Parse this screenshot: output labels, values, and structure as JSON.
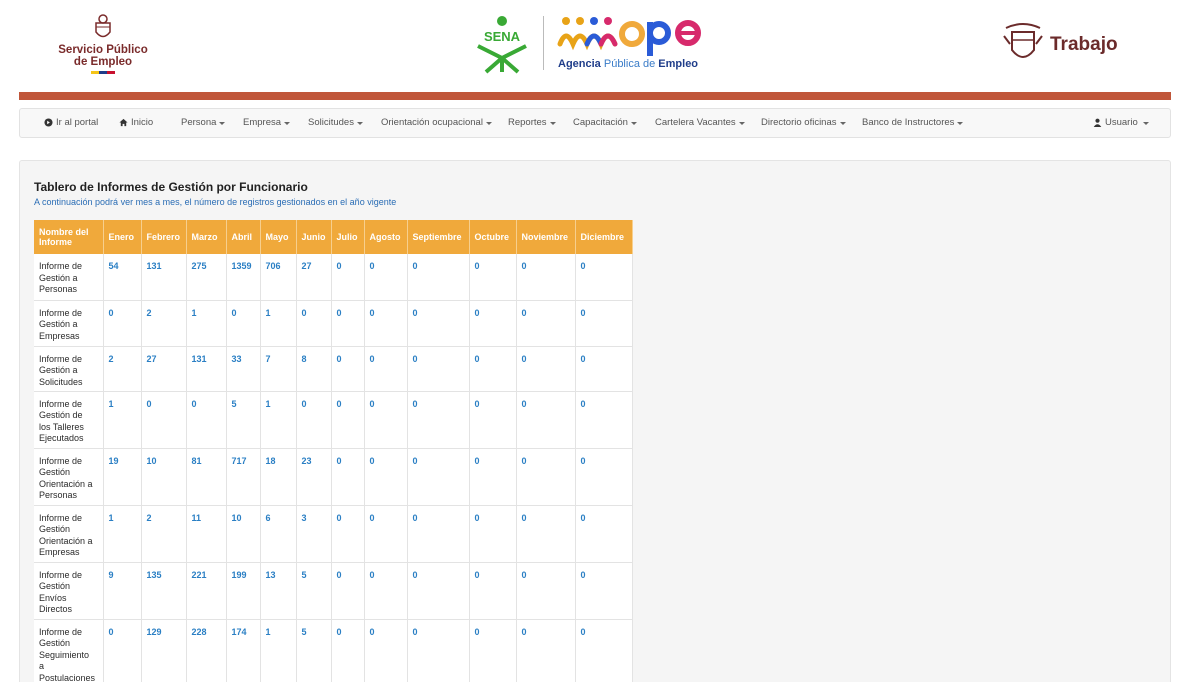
{
  "header": {
    "spe_logo_line1": "Servicio Público",
    "spe_logo_line2": "de Empleo",
    "sena_text": "SENA",
    "ape_sub_bold1": "Agencia",
    "ape_sub_light": "Pública de",
    "ape_sub_bold2": "Empleo",
    "trabajo_text": "Trabajo"
  },
  "navbar": {
    "items": [
      {
        "label": "Ir al portal"
      },
      {
        "label": "Inicio"
      },
      {
        "label": "Persona"
      },
      {
        "label": "Empresa"
      },
      {
        "label": "Solicitudes"
      },
      {
        "label": "Orientación ocupacional"
      },
      {
        "label": "Reportes"
      },
      {
        "label": "Capacitación"
      },
      {
        "label": "Cartelera Vacantes"
      },
      {
        "label": "Directorio oficinas"
      },
      {
        "label": "Banco de Instructores"
      }
    ],
    "user_label": "Usuario"
  },
  "panel": {
    "title": "Tablero de Informes de Gestión por Funcionario",
    "subtitle": "A continuación podrá ver mes a mes, el número de registros gestionados en el año vigente"
  },
  "table": {
    "headers": [
      "Nombre del Informe",
      "Enero",
      "Febrero",
      "Marzo",
      "Abril",
      "Mayo",
      "Junio",
      "Julio",
      "Agosto",
      "Septiembre",
      "Octubre",
      "Noviembre",
      "Diciembre"
    ],
    "rows": [
      {
        "name_lines": [
          "Informe de",
          "Gestión a",
          "Personas"
        ],
        "values": [
          "54",
          "131",
          "275",
          "1359",
          "706",
          "27",
          "0",
          "0",
          "0",
          "0",
          "0",
          "0"
        ]
      },
      {
        "name_lines": [
          "Informe de",
          "Gestión a",
          "Empresas"
        ],
        "values": [
          "0",
          "2",
          "1",
          "0",
          "1",
          "0",
          "0",
          "0",
          "0",
          "0",
          "0",
          "0"
        ]
      },
      {
        "name_lines": [
          "Informe de",
          "Gestión a",
          "Solicitudes"
        ],
        "values": [
          "2",
          "27",
          "131",
          "33",
          "7",
          "8",
          "0",
          "0",
          "0",
          "0",
          "0",
          "0"
        ]
      },
      {
        "name_lines": [
          "Informe de",
          "Gestión de",
          "los Talleres",
          "Ejecutados"
        ],
        "values": [
          "1",
          "0",
          "0",
          "5",
          "1",
          "0",
          "0",
          "0",
          "0",
          "0",
          "0",
          "0"
        ]
      },
      {
        "name_lines": [
          "Informe de",
          "Gestión",
          "Orientación a",
          "Personas"
        ],
        "values": [
          "19",
          "10",
          "81",
          "717",
          "18",
          "23",
          "0",
          "0",
          "0",
          "0",
          "0",
          "0"
        ]
      },
      {
        "name_lines": [
          "Informe de",
          "Gestión",
          "Orientación a",
          "Empresas"
        ],
        "values": [
          "1",
          "2",
          "11",
          "10",
          "6",
          "3",
          "0",
          "0",
          "0",
          "0",
          "0",
          "0"
        ]
      },
      {
        "name_lines": [
          "Informe de",
          "Gestión",
          "Envíos",
          "Directos"
        ],
        "values": [
          "9",
          "135",
          "221",
          "199",
          "13",
          "5",
          "0",
          "0",
          "0",
          "0",
          "0",
          "0"
        ]
      },
      {
        "name_lines": [
          "Informe de",
          "Gestión",
          "Seguimiento",
          "a",
          "Postulaciones"
        ],
        "values": [
          "0",
          "129",
          "228",
          "174",
          "1",
          "5",
          "0",
          "0",
          "0",
          "0",
          "0",
          "0"
        ]
      }
    ]
  },
  "colors": {
    "accent_bar": "#c0563a",
    "table_header": "#f0a93b",
    "link_blue": "#2a7fc4"
  }
}
